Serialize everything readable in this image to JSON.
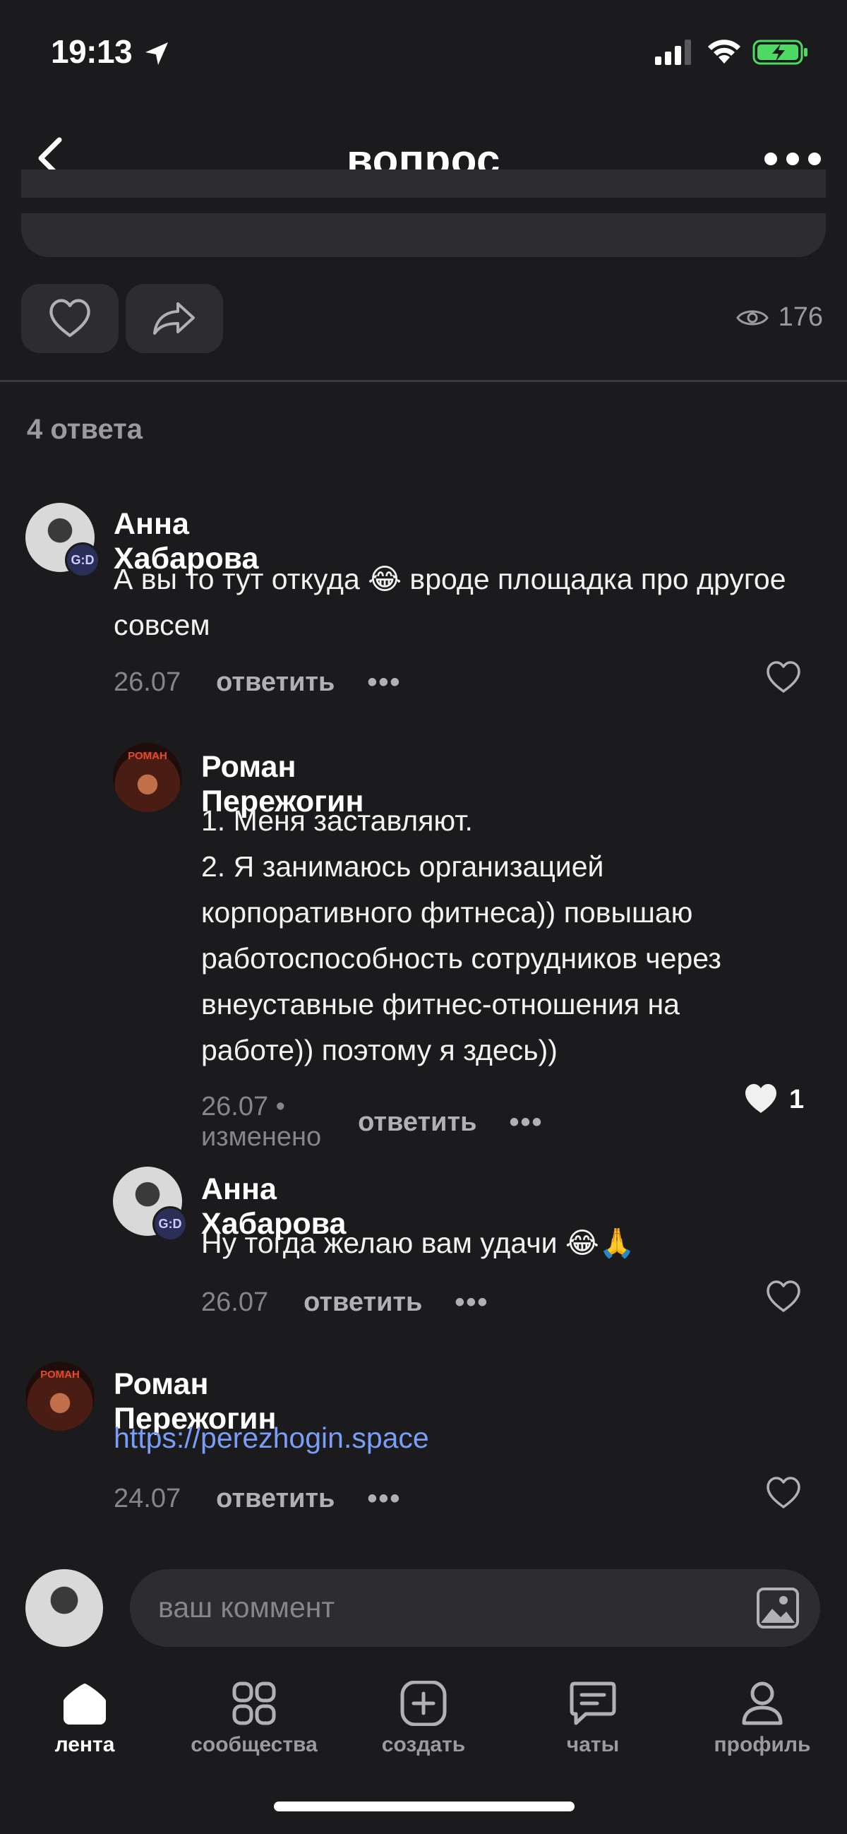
{
  "status_bar": {
    "time": "19:13"
  },
  "header": {
    "title": "вопрос"
  },
  "actions": {
    "views": "176"
  },
  "answers": {
    "count_label": "4 ответа"
  },
  "comments": [
    {
      "author": "Анна Хабарова",
      "text": "А вы то тут откуда 😂 вроде площадка про другое совсем",
      "date": "26.07",
      "reply": "ответить",
      "more": "•••",
      "badge": "G:D"
    },
    {
      "author": "Роман Пережогин",
      "text_lines": [
        "1. Меня заставляют.",
        "2. Я занимаюсь организацией",
        "корпоративного фитнеса)) повышаю",
        "работоспособность сотрудников через",
        "внеуставные фитнес-отношения на",
        "работе)) поэтому я здесь))"
      ],
      "date": "26.07",
      "edited": "• изменено",
      "reply": "ответить",
      "more": "•••",
      "likes": "1",
      "avatar_label": "РОМАН"
    },
    {
      "author": "Анна Хабарова",
      "text": "Ну тогда желаю вам удачи 😂🙏",
      "date": "26.07",
      "reply": "ответить",
      "more": "•••",
      "badge": "G:D"
    },
    {
      "author": "Роман Пережогин",
      "link": "https://perezhogin.space",
      "date": "24.07",
      "reply": "ответить",
      "more": "•••",
      "avatar_label": "РОМАН"
    }
  ],
  "comment_input": {
    "placeholder": "ваш коммент"
  },
  "tabs": [
    {
      "label": "лента",
      "icon": "home-icon",
      "active": true
    },
    {
      "label": "сообщества",
      "icon": "grid-icon"
    },
    {
      "label": "создать",
      "icon": "plus-square-icon"
    },
    {
      "label": "чаты",
      "icon": "chat-icon"
    },
    {
      "label": "профиль",
      "icon": "person-icon"
    }
  ],
  "colors": {
    "background": "#1b1b1d",
    "surface": "#2d2d30",
    "link": "#7a9df5",
    "muted": "#85858b",
    "battery": "#4cd964"
  }
}
